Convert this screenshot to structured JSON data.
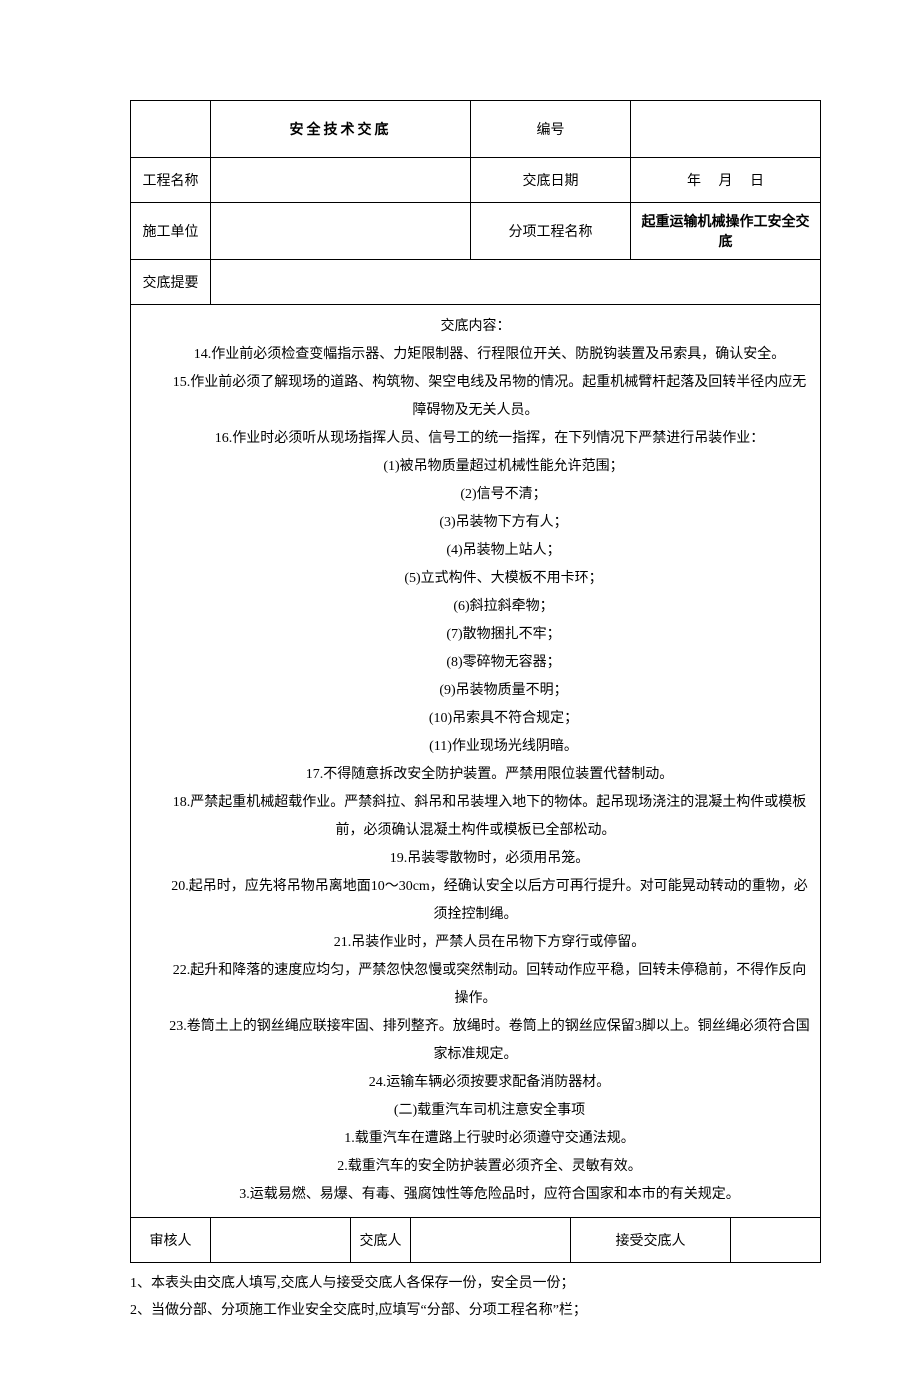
{
  "header": {
    "title": "安全技术交底",
    "serial_label": "编号",
    "serial_value": "",
    "project_name_label": "工程名称",
    "project_name_value": "",
    "date_label": "交底日期",
    "date_value": "年　 月　 日",
    "unit_label": "施工单位",
    "unit_value": "",
    "subproject_label": "分项工程名称",
    "subproject_value": "起重运输机械操作工安全交底",
    "summary_label": "交底提要",
    "summary_value": ""
  },
  "content": {
    "heading": "交底内容：",
    "lines": [
      "14.作业前必须检查变幅指示器、力矩限制器、行程限位开关、防脱钩装置及吊索具，确认安全。",
      "15.作业前必须了解现场的道路、构筑物、架空电线及吊物的情况。起重机械臂杆起落及回转半径内应无障碍物及无关人员。",
      "16.作业时必须听从现场指挥人员、信号工的统一指挥，在下列情况下严禁进行吊装作业：",
      "(1)被吊物质量超过机械性能允许范围；",
      "(2)信号不清；",
      "(3)吊装物下方有人；",
      "(4)吊装物上站人；",
      "(5)立式构件、大模板不用卡环；",
      "(6)斜拉斜牵物；",
      "(7)散物捆扎不牢；",
      "(8)零碎物无容器；",
      "(9)吊装物质量不明；",
      "(10)吊索具不符合规定；",
      "(11)作业现场光线阴暗。",
      "17.不得随意拆改安全防护装置。严禁用限位装置代替制动。",
      "18.严禁起重机械超载作业。严禁斜拉、斜吊和吊装埋入地下的物体。起吊现场浇注的混凝土构件或模板前，必须确认混凝土构件或模板已全部松动。",
      "19.吊装零散物时，必须用吊笼。",
      "20.起吊时，应先将吊物吊离地面10～30cm，经确认安全以后方可再行提升。对可能晃动转动的重物，必须拴控制绳。",
      "21.吊装作业时，严禁人员在吊物下方穿行或停留。",
      "22.起升和降落的速度应均匀，严禁忽快忽慢或突然制动。回转动作应平稳，回转未停稳前，不得作反向操作。",
      "23.卷筒土上的钢丝绳应联接牢固、排列整齐。放绳时。卷筒上的钢丝应保留3脚以上。铜丝绳必须符合国家标准规定。",
      "24.运输车辆必须按要求配备消防器材。",
      "(二)载重汽车司机注意安全事项",
      "1.载重汽车在遭路上行驶时必须遵守交通法规。",
      "2.载重汽车的安全防护装置必须齐全、灵敏有效。",
      "3.运载易燃、易爆、有毒、强腐蚀性等危险品时，应符合国家和本市的有关规定。"
    ]
  },
  "footer": {
    "reviewer_label": "审核人",
    "reviewer_value": "",
    "presenter_label": "交底人",
    "presenter_value": "",
    "receiver_label": "接受交底人",
    "receiver_value": ""
  },
  "notes": {
    "n1": "1、本表头由交底人填写,交底人与接受交底人各保存一份，安全员一份；",
    "n2": "2、当做分部、分项施工作业安全交底时,应填写“分部、分项工程名称”栏；"
  }
}
